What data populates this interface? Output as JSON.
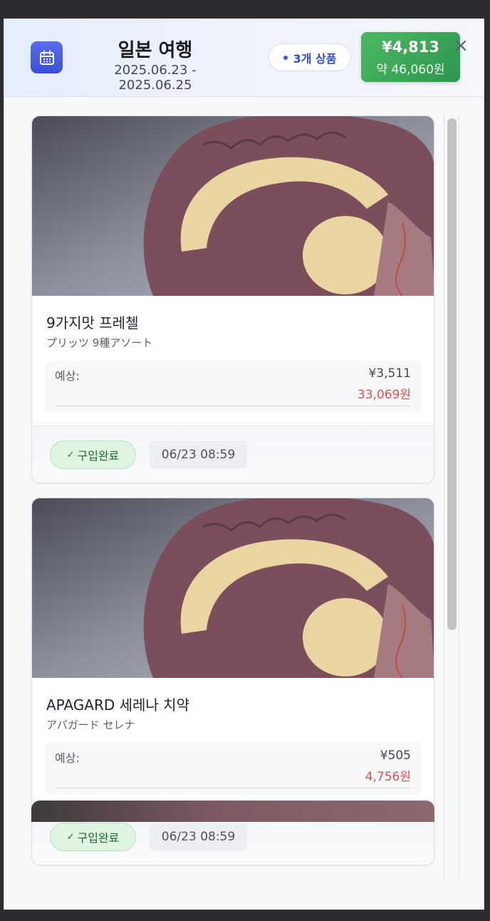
{
  "header": {
    "icon": "calendar-icon",
    "title": "일본 여행",
    "dates": "2025.06.23 - 2025.06.25",
    "item_count": "3개 상품",
    "total_yen": "¥4,813",
    "total_won": "약 46,060원",
    "close": "×"
  },
  "items": [
    {
      "image": "brain-model-photo",
      "name": "9가지맛 프레첼",
      "sub": "プリッツ 9種アソート",
      "price_label": "예상:",
      "price_yen": "¥3,511",
      "price_won": "33,069원",
      "status": "구입완료",
      "status_check": "✓",
      "time": "06/23 08:59"
    },
    {
      "image": "brain-model-photo",
      "name": "APAGARD 세레나 치약",
      "sub": "アパガード セレナ",
      "price_label": "예상:",
      "price_yen": "¥505",
      "price_won": "4,756원",
      "status": "구입완료",
      "status_check": "✓",
      "time": "06/23 08:59"
    }
  ],
  "colors": {
    "accent": "#3a4fd8",
    "total_green": "#3aa556",
    "won_red": "#e0524b",
    "status_green": "#1f6b33"
  }
}
